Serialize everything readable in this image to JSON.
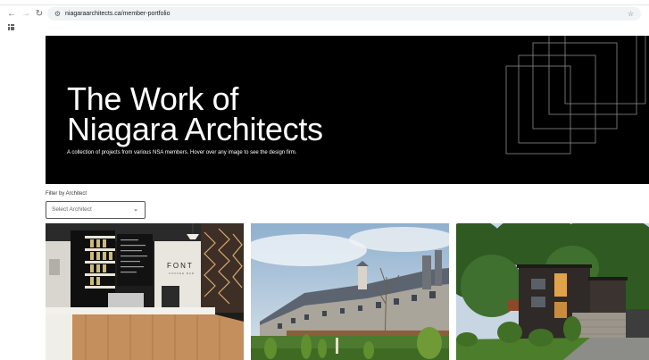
{
  "browser": {
    "url": "niagaraarchitects.ca/member-portfolio",
    "icons": {
      "back": "back-arrow-icon",
      "forward": "forward-arrow-icon",
      "reload": "reload-icon",
      "site_info": "site-info-icon",
      "bookmark": "star-icon",
      "apps": "apps-grid-icon"
    }
  },
  "hero": {
    "title_line1": "The Work of",
    "title_line2": "Niagara Architects",
    "subtitle": "A collection of projects from various NSA members. Hover over any image to see the design firm."
  },
  "filter": {
    "label": "Filter by Architect",
    "selected": "Select Architect"
  },
  "gallery": {
    "items": [
      {
        "sign_text": "FONT",
        "sign_subtext": "COFFEE BAR"
      },
      {
        "sign_text": ""
      },
      {
        "sign_text": ""
      }
    ]
  },
  "colors": {
    "hero_bg": "#000000",
    "hero_text": "#ffffff",
    "omnibox_bg": "#f1f3f4"
  }
}
